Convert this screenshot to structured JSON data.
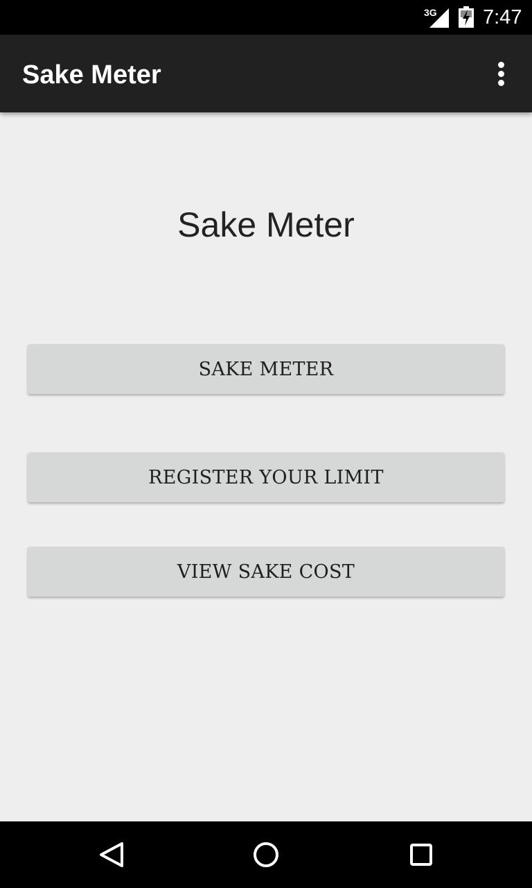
{
  "status_bar": {
    "network": "3G",
    "time": "7:47",
    "icons": [
      "signal-icon",
      "battery-charging-icon"
    ]
  },
  "app_bar": {
    "title": "Sake Meter",
    "overflow_icon": "more-vert-icon"
  },
  "main": {
    "heading": "Sake Meter",
    "buttons": [
      {
        "label": "SAKE METER"
      },
      {
        "label": "REGISTER YOUR LIMIT"
      },
      {
        "label": "VIEW SAKE COST"
      }
    ]
  },
  "nav_bar": {
    "icons": [
      "back-icon",
      "home-icon",
      "recents-icon"
    ]
  },
  "colors": {
    "status_bar": "#000000",
    "app_bar": "#212121",
    "background": "#eeeeee",
    "button": "#d6d7d7",
    "nav_bar": "#000000"
  }
}
